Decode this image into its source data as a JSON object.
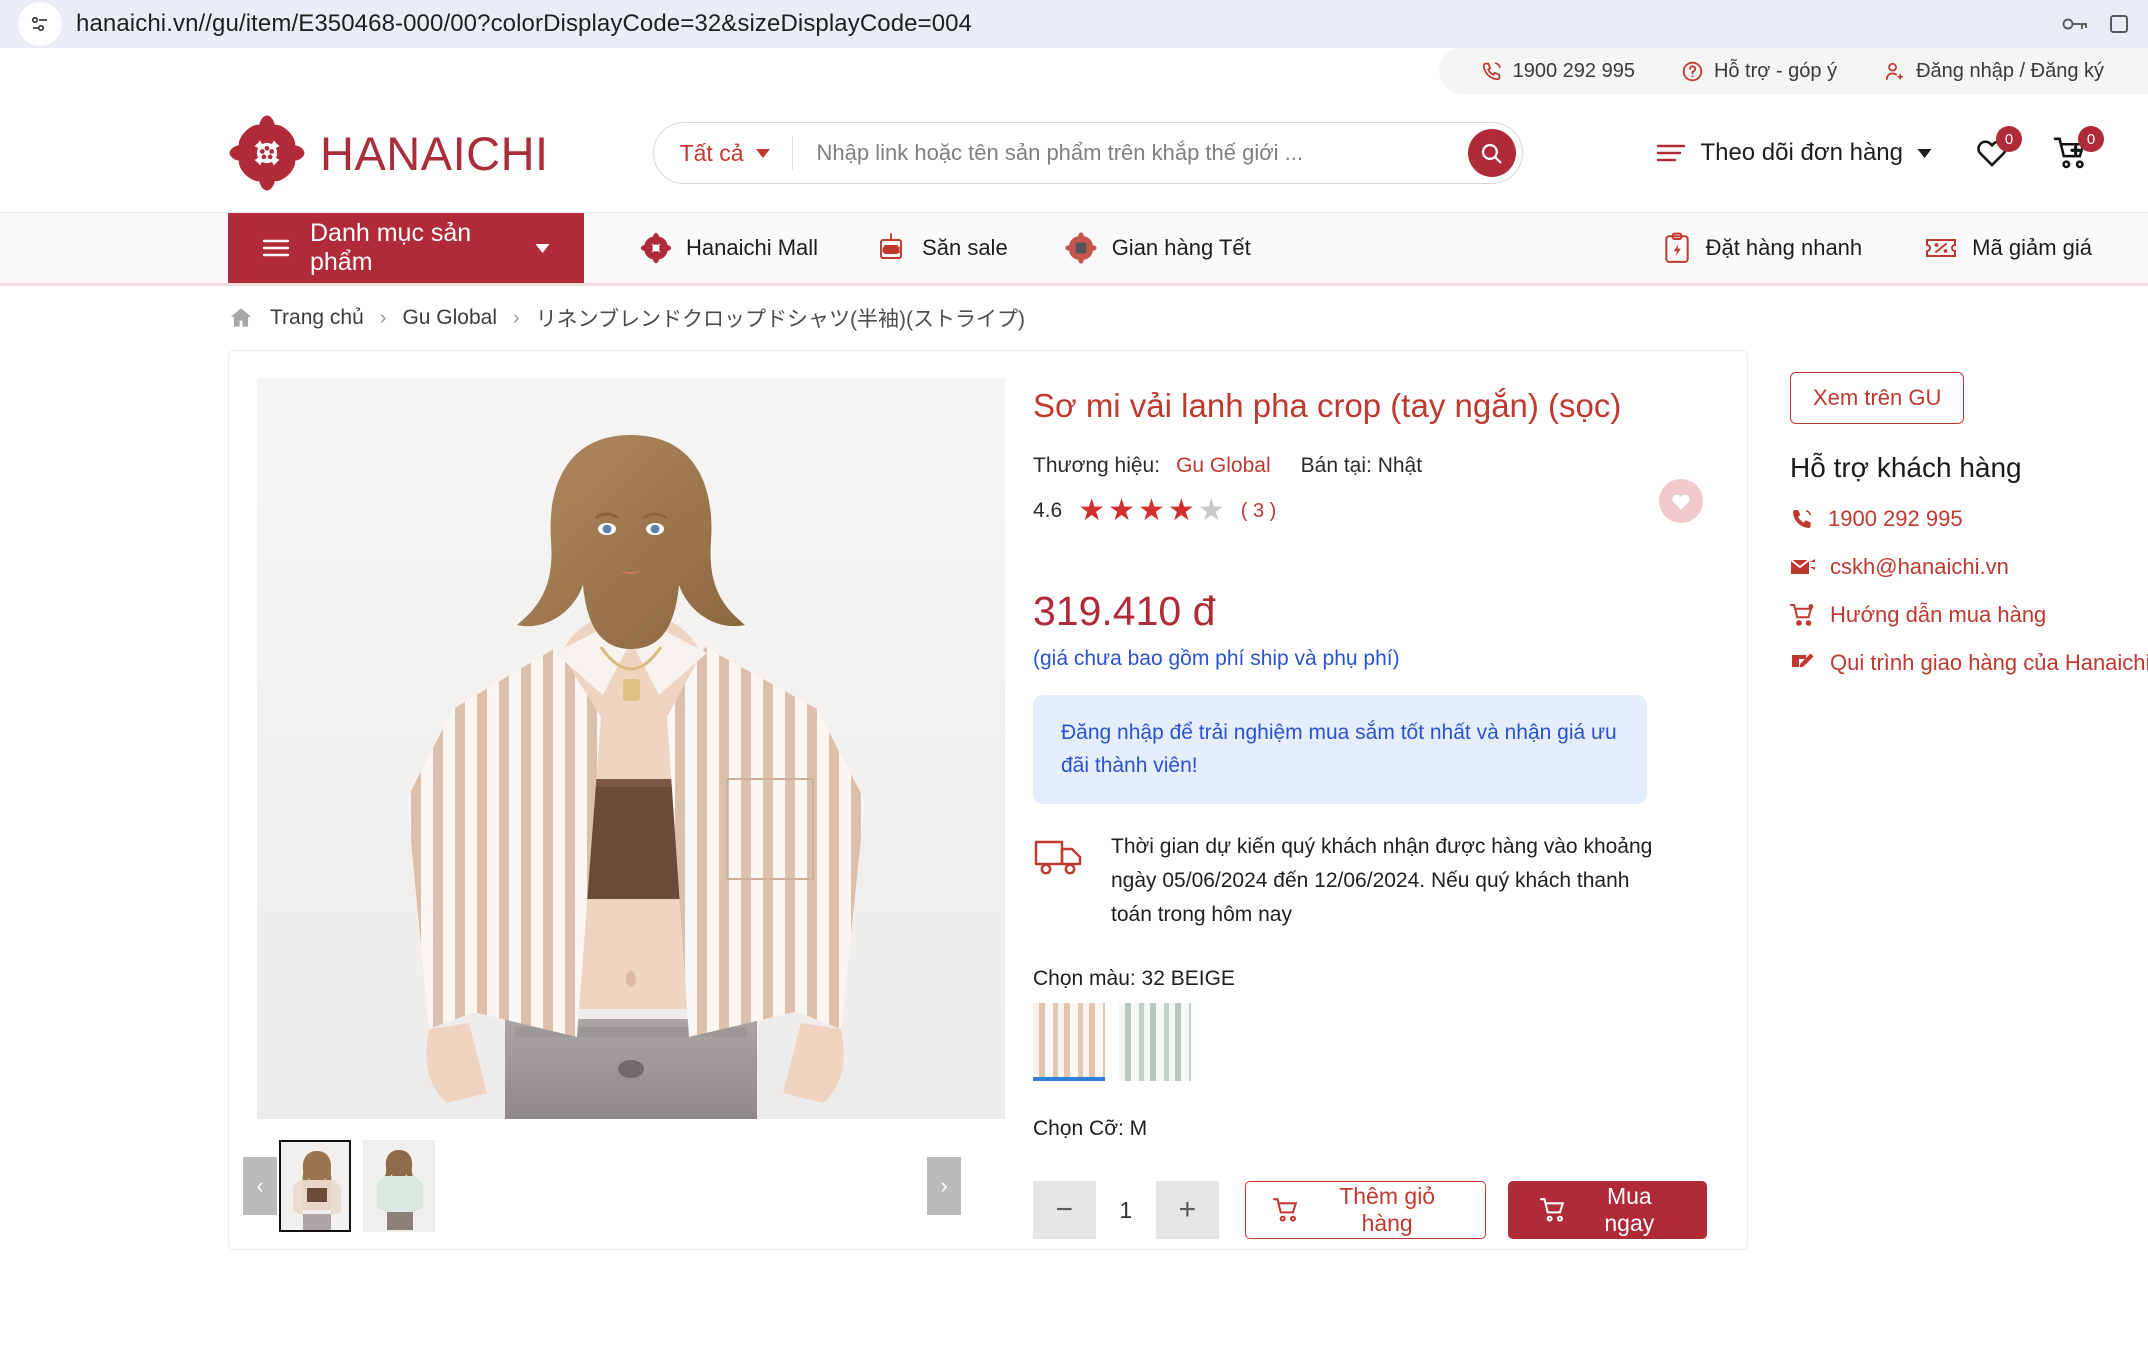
{
  "browser": {
    "url": "hanaichi.vn//gu/item/E350468-000/00?colorDisplayCode=32&sizeDisplayCode=004",
    "site_info_icon": "site-settings-icon",
    "key_icon": "password-key-icon",
    "menu_icon": "browser-menu-icon"
  },
  "topbar": {
    "hotline": "1900 292 995",
    "support": "Hỗ trợ - góp ý",
    "account": "Đăng nhập / Đăng ký"
  },
  "header": {
    "logo_text_bold": "HANA",
    "logo_text_light": "ICHI",
    "search": {
      "category": "Tất cả",
      "placeholder": "Nhập link hoặc tên sản phẩm trên khắp thế giới ...",
      "value": ""
    },
    "track_order": "Theo dõi đơn hàng",
    "wishlist_count": "0",
    "cart_count": "0"
  },
  "nav": {
    "category_button": "Danh mục sản phẩm",
    "links": [
      {
        "label": "Hanaichi Mall",
        "icon": "hanaichi-flower-icon"
      },
      {
        "label": "Săn sale",
        "icon": "sale-tag-icon"
      },
      {
        "label": "Gian hàng Tết",
        "icon": "tet-booth-icon"
      }
    ],
    "right_links": [
      {
        "label": "Đặt hàng nhanh",
        "icon": "quick-order-icon"
      },
      {
        "label": "Mã giảm giá",
        "icon": "discount-code-icon"
      }
    ]
  },
  "breadcrumb": {
    "home": "Trang chủ",
    "category": "Gu Global",
    "current": "リネンブレンドクロップドシャツ(半袖)(ストライプ)",
    "separator": "›"
  },
  "product": {
    "title": "Sơ mi vải lanh pha crop (tay ngắn) (sọc)",
    "brand_label": "Thương hiệu:",
    "brand_name": "Gu Global",
    "sold_in": "Bán tại: Nhật",
    "rating_value": "4.6",
    "rating_stars_filled": 4,
    "rating_stars_total": 5,
    "review_count": "( 3 )",
    "price": "319.410 đ",
    "price_note": "(giá chưa bao gồm phí ship và phụ phí)",
    "login_promo": "Đăng nhập để trải nghiệm mua sắm tốt nhất và nhận giá ưu đãi thành viên!",
    "shipping_note": "Thời gian dự kiến quý khách nhận được hàng vào khoảng ngày 05/06/2024 đến 12/06/2024. Nếu quý khách thanh toán trong hôm nay",
    "color_label": "Chọn màu: 32 BEIGE",
    "colors": [
      {
        "name": "32 BEIGE",
        "selected": true
      },
      {
        "name": "GREEN",
        "selected": false
      }
    ],
    "size_label": "Chọn Cỡ: M",
    "quantity": "1",
    "decrease_label": "−",
    "increase_label": "+",
    "add_to_cart": "Thêm giỏ hàng",
    "buy_now": "Mua ngay",
    "wishlist_icon": "heart-icon",
    "gallery": {
      "prev": "‹",
      "next": "›",
      "thumb_count": 2
    }
  },
  "sidebar": {
    "view_on_gu": "Xem trên GU",
    "support_title": "Hỗ trợ khách hàng",
    "items": [
      {
        "label": "1900 292 995",
        "icon": "phone-icon"
      },
      {
        "label": "cskh@hanaichi.vn",
        "icon": "email-icon"
      },
      {
        "label": "Hướng dẫn mua hàng",
        "icon": "cart-guide-icon"
      },
      {
        "label": "Qui trình giao hàng của Hanaichi",
        "icon": "delivery-process-icon"
      }
    ]
  },
  "colors": {
    "brand_red": "#b02a37",
    "link_red": "#c0392f",
    "promo_blue": "#2a52d0",
    "promo_bg": "#e5eefc",
    "select_blue": "#2f80d8"
  }
}
